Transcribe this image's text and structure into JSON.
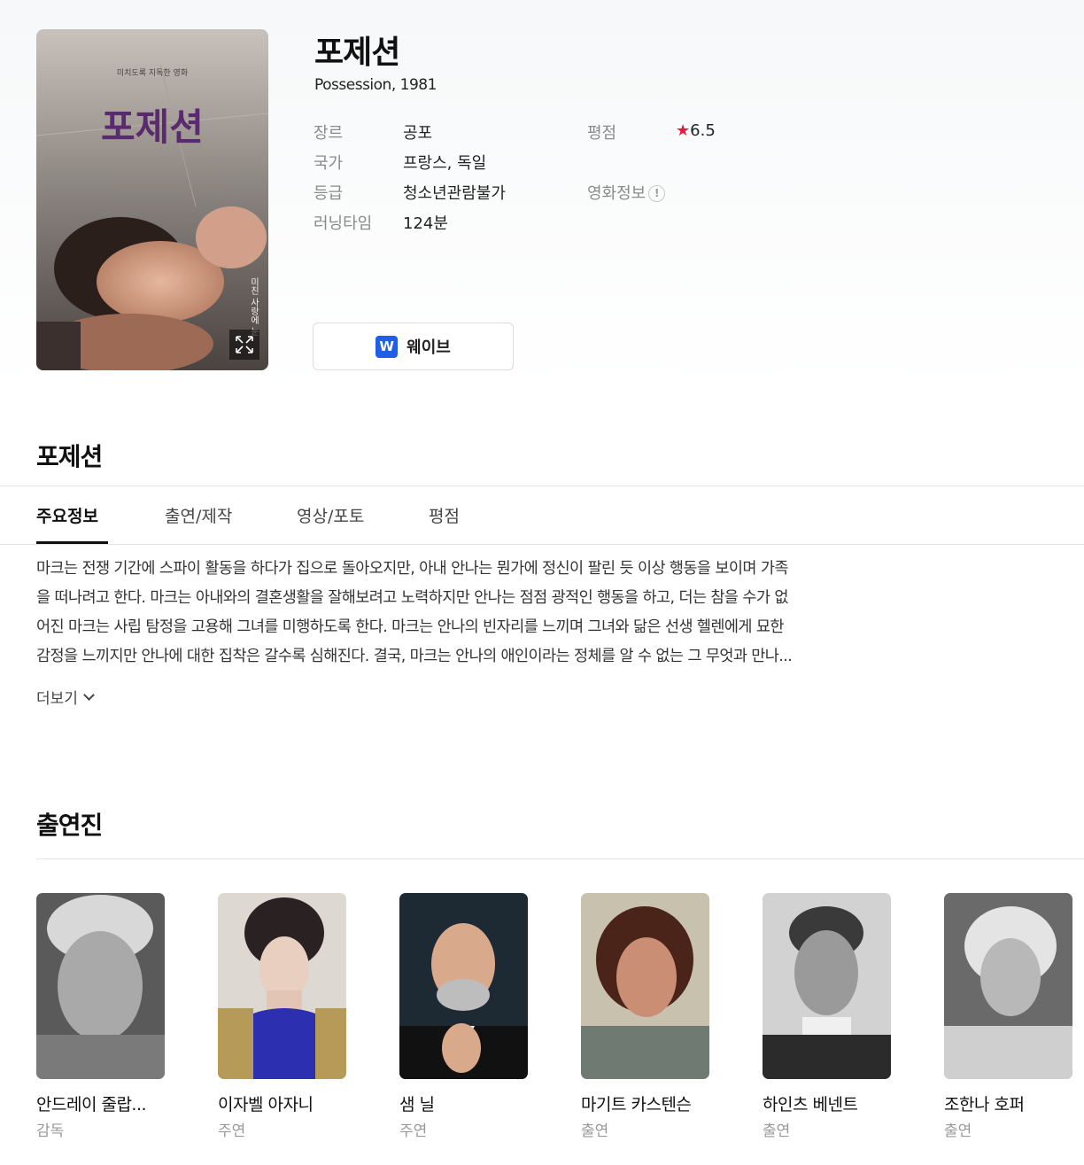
{
  "movie": {
    "title": "포제션",
    "original": "Possession, 1981",
    "poster": {
      "tagline_top": "미치도록 지독한 영화",
      "title_text": "포제션",
      "vertical_text": "미친 사랑에 눈"
    },
    "info": {
      "genre_label": "장르",
      "genre_value": "공포",
      "country_label": "국가",
      "country_value": "프랑스, 독일",
      "rating_label": "등급",
      "rating_value": "청소년관람불가",
      "runtime_label": "러닝타임",
      "runtime_value": "124분",
      "score_label": "평점",
      "score_value": "6.5",
      "movieinfo_label": "영화정보"
    },
    "watch": {
      "provider_label": "웨이브",
      "logo_letter": "W"
    }
  },
  "section": {
    "title": "포제션"
  },
  "tabs": [
    {
      "label": "주요정보",
      "active": true
    },
    {
      "label": "출연/제작",
      "active": false
    },
    {
      "label": "영상/포토",
      "active": false
    },
    {
      "label": "평점",
      "active": false
    }
  ],
  "synopsis": {
    "lines": [
      "마크는 전쟁 기간에 스파이 활동을 하다가 집으로 돌아오지만, 아내 안나는 뭔가에 정신이 팔린 듯 이상 행동을 보이며 가족",
      "을 떠나려고 한다. 마크는 아내와의 결혼생활을 잘해보려고 노력하지만 안나는 점점 광적인 행동을 하고, 더는 참을 수가 없",
      "어진 마크는 사립 탐정을 고용해 그녀를 미행하도록 한다. 마크는 안나의 빈자리를 느끼며 그녀와 닮은 선생 헬렌에게 묘한",
      "감정을 느끼지만 안나에 대한 집착은 갈수록 심해진다. 결국, 마크는 안나의 애인이라는 정체를 알 수 없는 그 무엇과 만나..."
    ],
    "more_label": "더보기"
  },
  "cast": {
    "title": "출연진",
    "members": [
      {
        "name": "안드레이 줄랍...",
        "role": "감독"
      },
      {
        "name": "이자벨 아자니",
        "role": "주연"
      },
      {
        "name": "샘 닐",
        "role": "주연"
      },
      {
        "name": "마기트 카스텐슨",
        "role": "출연"
      },
      {
        "name": "하인츠 베넨트",
        "role": "출연"
      },
      {
        "name": "조한나 호퍼",
        "role": "출연"
      }
    ]
  },
  "colors": {
    "star": "#e8193c",
    "wavve": "#1f5ee6",
    "label_gray": "#8a8a8a"
  }
}
